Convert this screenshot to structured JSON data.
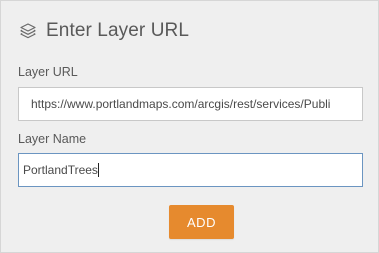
{
  "header": {
    "title": "Enter Layer URL",
    "icon": "layers-icon"
  },
  "layer_url": {
    "label": "Layer URL",
    "value": "https://www.portlandmaps.com/arcgis/rest/services/Publi"
  },
  "layer_name": {
    "label": "Layer Name",
    "value": "PortlandTrees"
  },
  "add_button": {
    "label": "ADD"
  },
  "colors": {
    "panel_background": "#efefef",
    "accent_button": "#e68a2e",
    "focused_border": "#6b95c1"
  }
}
